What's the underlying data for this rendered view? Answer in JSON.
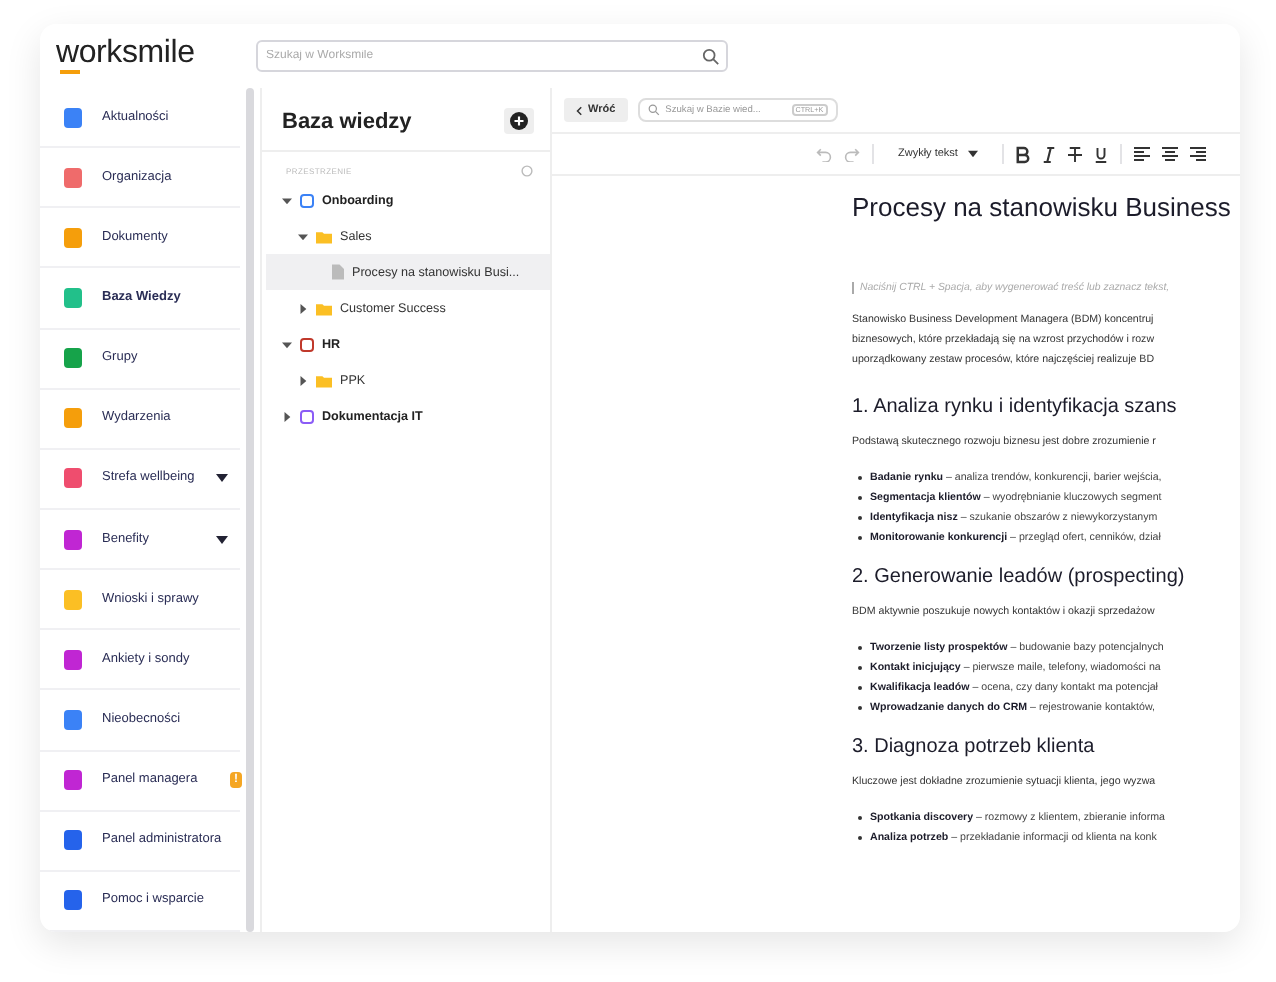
{
  "header": {
    "logo": "worksmile",
    "search": {
      "placeholder": "Szukaj w Worksmile"
    }
  },
  "sidebar": {
    "items": [
      {
        "label": "Aktualności",
        "selected": false
      },
      {
        "label": "Organizacja",
        "selected": false
      },
      {
        "label": "Dokumenty",
        "selected": false
      },
      {
        "label": "Baza Wiedzy",
        "selected": true
      },
      {
        "label": "Grupy",
        "selected": false
      },
      {
        "label": "Wydarzenia",
        "selected": false
      },
      {
        "label": "Strefa wellbeing",
        "selected": false,
        "expandable": true
      },
      {
        "label": "Benefity",
        "selected": false,
        "expandable": true
      },
      {
        "label": "Wnioski i sprawy",
        "selected": false
      },
      {
        "label": "Ankiety i sondy",
        "selected": false
      },
      {
        "label": "Nieobecności",
        "selected": false
      },
      {
        "label": "Panel managera",
        "selected": false,
        "badge": "!"
      },
      {
        "label": "Panel administratora",
        "selected": false
      },
      {
        "label": "Pomoc i wsparcie",
        "selected": false
      }
    ]
  },
  "knowledge_panel": {
    "title": "Baza wiedzy",
    "section_label": "PRZESTRZENIE",
    "tree": [
      {
        "label": "Onboarding",
        "kind": "space",
        "color": "#3b82f6",
        "expanded": true,
        "selected": false,
        "children": [
          {
            "label": "Sales",
            "kind": "folder",
            "expanded": true,
            "selected": false,
            "children": [
              {
                "label": "Procesy na stanowisku Busi...",
                "kind": "page",
                "selected": true
              }
            ]
          },
          {
            "label": "Customer Success",
            "kind": "folder",
            "expanded": false,
            "selected": false
          }
        ]
      },
      {
        "label": "HR",
        "kind": "space",
        "color": "#c0392b",
        "expanded": true,
        "selected": false,
        "children": [
          {
            "label": "PPK",
            "kind": "folder",
            "expanded": false,
            "selected": false
          }
        ]
      },
      {
        "label": "Dokumentacja IT",
        "kind": "space",
        "color": "#8b5cf6",
        "expanded": false,
        "selected": false
      }
    ]
  },
  "topbar": {
    "back": "Wróć",
    "search": {
      "placeholder": "Szukaj w Bazie wied...",
      "shortcut": "CTRL+K"
    }
  },
  "toolbar": {
    "style_select": "Zwykły tekst"
  },
  "document": {
    "title": "Procesy na stanowisku Business",
    "hint": "Naciśnij CTRL + Spacja, aby wygenerować treść lub zaznacz tekst,",
    "intro": [
      "Stanowisko Business Development Managera (BDM) koncentruj",
      "biznesowych, które przekładają się na wzrost przychodów i rozw",
      "uporządkowany zestaw procesów, które najczęściej realizuje BD"
    ],
    "sections": [
      {
        "heading": "1. Analiza rynku i identyfikacja szans",
        "text": "Podstawą skutecznego rozwoju biznesu jest dobre zrozumienie r",
        "bullets": [
          "**Badanie rynku** – analiza trendów, konkurencji, barier wejścia,",
          "**Segmentacja klientów** – wyodrębnianie kluczowych segment",
          "**Identyfikacja nisz** – szukanie obszarów z niewykorzystanym",
          "**Monitorowanie konkurencji** – przegląd ofert, cenników, dział"
        ]
      },
      {
        "heading": "2. Generowanie leadów (prospecting)",
        "text": "BDM aktywnie poszukuje nowych kontaktów i okazji sprzedażow",
        "bullets": [
          "**Tworzenie listy prospektów** – budowanie bazy potencjalnych",
          "**Kontakt inicjujący** – pierwsze maile, telefony, wiadomości na",
          "**Kwalifikacja leadów** – ocena, czy dany kontakt ma potencjał",
          "**Wprowadzanie danych do CRM** – rejestrowanie kontaktów,"
        ]
      },
      {
        "heading": "3. Diagnoza potrzeb klienta",
        "text": "Kluczowe jest dokładne zrozumienie sytuacji klienta, jego wyzwa",
        "bullets": [
          "**Spotkania discovery** – rozmowy z klientem, zbieranie informa",
          "**Analiza potrzeb** – przekładanie informacji od klienta na konk"
        ]
      }
    ]
  }
}
